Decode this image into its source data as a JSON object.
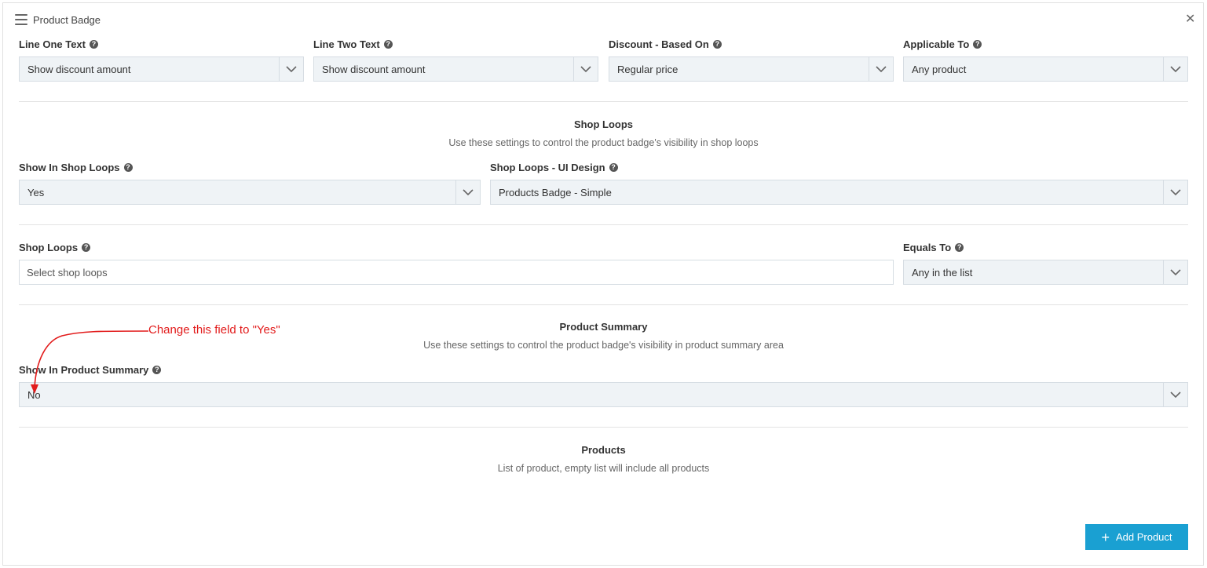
{
  "header": {
    "title": "Product Badge"
  },
  "row1": [
    {
      "label": "Line One Text",
      "value": "Show discount amount"
    },
    {
      "label": "Line Two Text",
      "value": "Show discount amount"
    },
    {
      "label": "Discount - Based On",
      "value": "Regular price"
    },
    {
      "label": "Applicable To",
      "value": "Any product"
    }
  ],
  "shop_loops_section": {
    "title": "Shop Loops",
    "subtitle": "Use these settings to control the product badge's visibility in shop loops",
    "show_label": "Show In Shop Loops",
    "show_value": "Yes",
    "design_label": "Shop Loops - UI Design",
    "design_value": "Products Badge - Simple",
    "loops_label": "Shop Loops",
    "loops_placeholder": "Select shop loops",
    "equals_label": "Equals To",
    "equals_value": "Any in the list"
  },
  "product_summary_section": {
    "title": "Product Summary",
    "subtitle": "Use these settings to control the product badge's visibility in product summary area",
    "show_label": "Show In Product Summary",
    "show_value": "No"
  },
  "annotation": {
    "text": "Change this field to \"Yes\"",
    "color": "#e21b1b"
  },
  "products_section": {
    "title": "Products",
    "subtitle": "List of product, empty list will include all products",
    "add_label": "Add Product"
  },
  "colors": {
    "accent": "#1aa0d2",
    "field_bg": "#eff3f6"
  },
  "icons": {
    "help": "question-circle-icon",
    "menu": "hamburger-icon",
    "close": "close-icon",
    "dropdown": "chevron-down-icon",
    "add": "plus-icon"
  }
}
